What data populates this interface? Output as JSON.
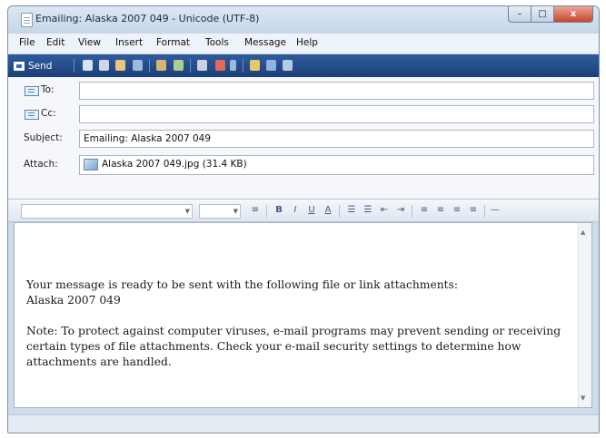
{
  "window": {
    "title": "Emailing: Alaska 2007 049 - Unicode (UTF-8)",
    "controls": {
      "minimize": "–",
      "maximize": "□",
      "close": "x"
    }
  },
  "menu": [
    "File",
    "Edit",
    "View",
    "Insert",
    "Format",
    "Tools",
    "Message",
    "Help"
  ],
  "toolbar": {
    "send_label": "Send",
    "icons": [
      "cut-icon",
      "copy-icon",
      "paste-icon",
      "undo-icon",
      "check-names-icon",
      "spelling-icon",
      "attach-icon",
      "priority-icon",
      "sign-icon",
      "encrypt-icon",
      "offline-icon"
    ]
  },
  "header": {
    "to_label": "To:",
    "to_value": "",
    "cc_label": "Cc:",
    "cc_value": "",
    "subject_label": "Subject:",
    "subject_value": "Emailing: Alaska 2007 049",
    "attach_label": "Attach:",
    "attachment": "Alaska 2007 049.jpg (31.4 KB)"
  },
  "format_toolbar": {
    "font_name": "",
    "font_size": "",
    "buttons": [
      "B",
      "I",
      "U",
      "A"
    ]
  },
  "message": {
    "line1": "Your message is ready to be sent with the following file or link attachments:",
    "line2": "Alaska 2007 049",
    "note": "Note: To protect against computer viruses, e-mail programs may prevent sending or receiving certain types of file attachments.  Check your e-mail security settings to determine how attachments are handled."
  },
  "colors": {
    "toolbar_bg": "#2a5393",
    "window_frame": "#ccdcea",
    "accent_close": "#c9452c"
  }
}
